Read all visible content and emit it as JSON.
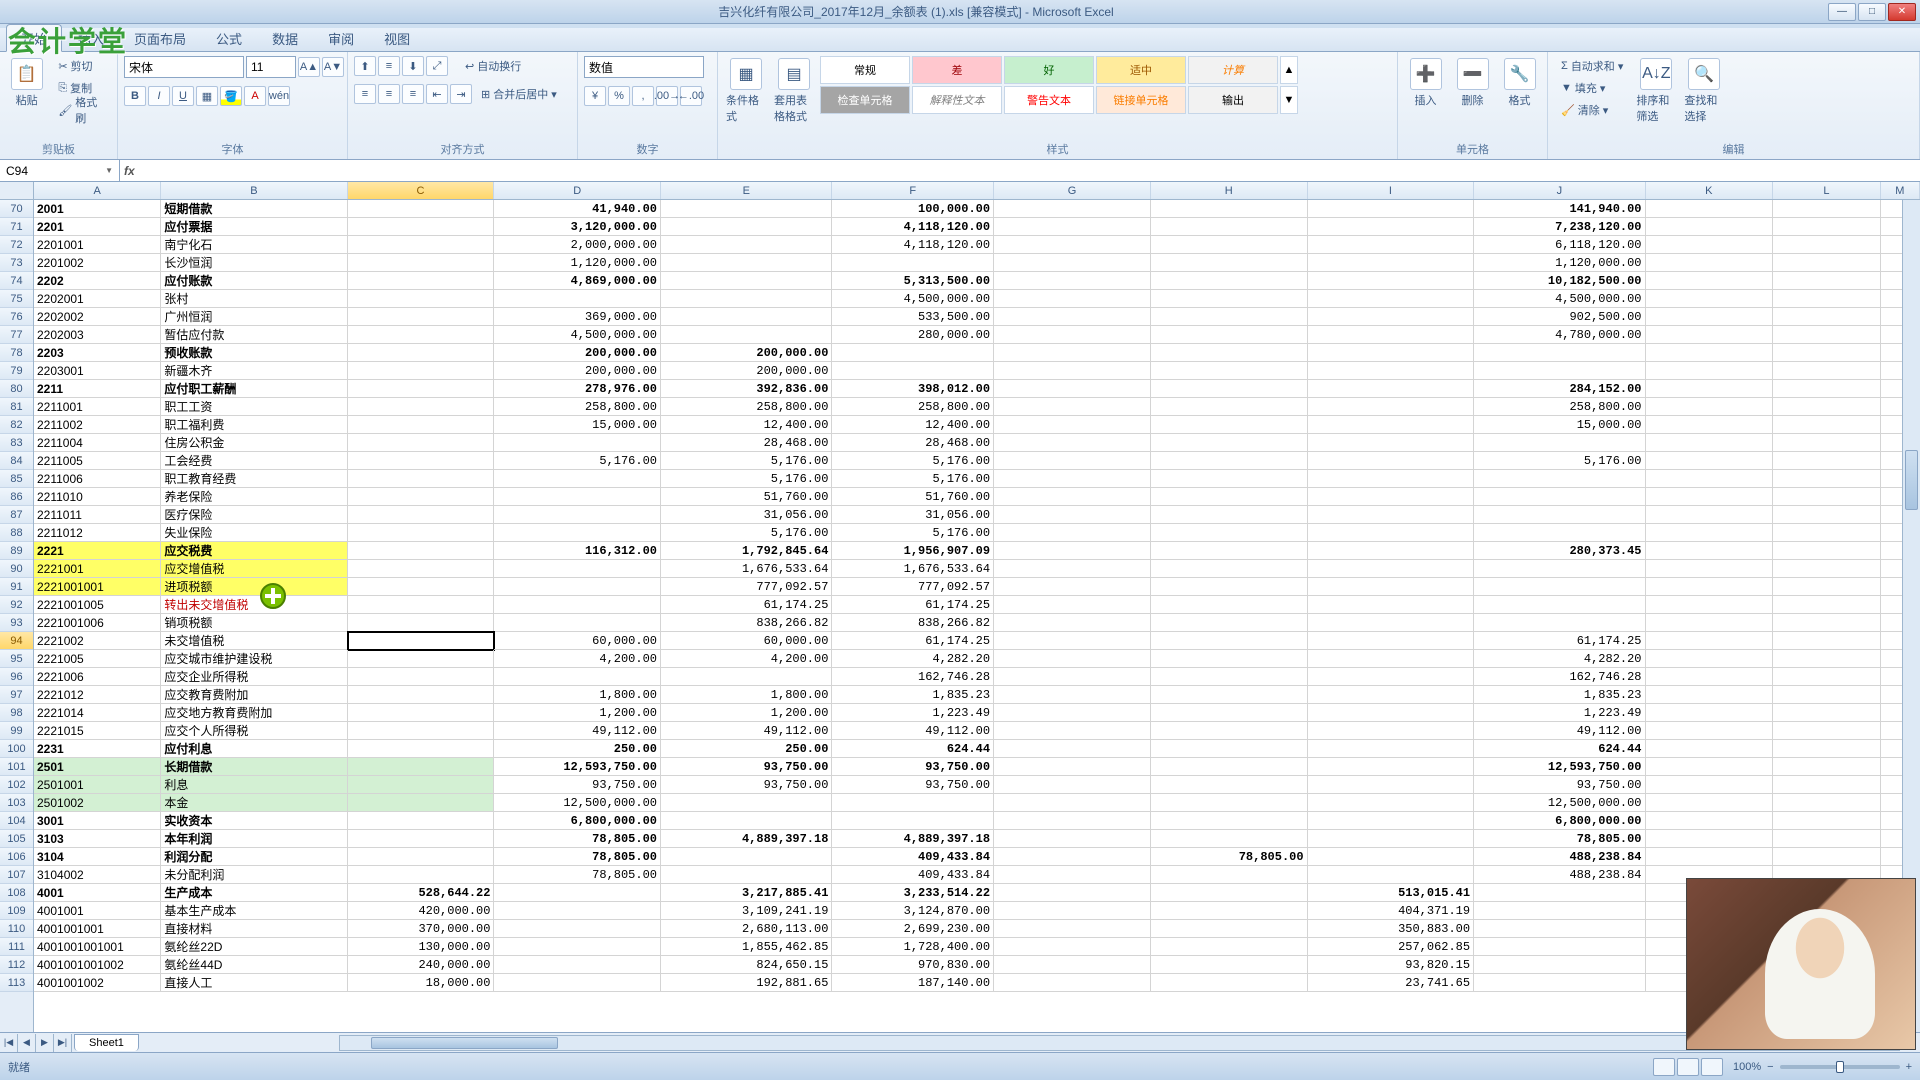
{
  "window": {
    "title": "吉兴化纤有限公司_2017年12月_余额表 (1).xls [兼容模式] - Microsoft Excel"
  },
  "logo": "会计学堂",
  "menu": {
    "tabs": [
      "开始",
      "插入",
      "页面布局",
      "公式",
      "数据",
      "审阅",
      "视图"
    ],
    "activeIndex": 0
  },
  "ribbon": {
    "clipboard": {
      "paste": "粘贴",
      "cut": "剪切",
      "copy": "复制",
      "formatPainter": "格式刷",
      "label": "剪贴板"
    },
    "font": {
      "name": "宋体",
      "size": "11",
      "bold": "B",
      "italic": "I",
      "underline": "U",
      "label": "字体"
    },
    "align": {
      "wrap": "自动换行",
      "merge": "合并后居中",
      "label": "对齐方式"
    },
    "number": {
      "format": "数值",
      "pct": "%",
      "comma": ",",
      "label": "数字"
    },
    "styles": {
      "condfmt": "条件格式",
      "tablefmt": "套用表格格式",
      "cellstyle": "单元格样式",
      "gallery": [
        {
          "k": "normal",
          "t": "常规"
        },
        {
          "k": "bad",
          "t": "差"
        },
        {
          "k": "good",
          "t": "好"
        },
        {
          "k": "neutral",
          "t": "适中"
        },
        {
          "k": "calc",
          "t": "计算"
        },
        {
          "k": "check",
          "t": "检查单元格"
        },
        {
          "k": "explain",
          "t": "解释性文本"
        },
        {
          "k": "warn",
          "t": "警告文本"
        },
        {
          "k": "linked",
          "t": "链接单元格"
        },
        {
          "k": "output",
          "t": "输出"
        }
      ],
      "label": "样式"
    },
    "cells": {
      "insert": "插入",
      "delete": "删除",
      "format": "格式",
      "label": "单元格"
    },
    "editing": {
      "autosum": "自动求和",
      "fill": "填充",
      "clear": "清除",
      "sortfilter": "排序和筛选",
      "findselect": "查找和选择",
      "label": "编辑"
    }
  },
  "fbar": {
    "name": "C94",
    "fx": "fx",
    "value": ""
  },
  "cols": [
    "A",
    "B",
    "C",
    "D",
    "E",
    "F",
    "G",
    "H",
    "I",
    "J",
    "K",
    "L",
    "M"
  ],
  "colClasses": [
    "cA",
    "cB",
    "cC",
    "cD",
    "cE",
    "cF",
    "cG",
    "cH",
    "cI",
    "cJ",
    "cK",
    "cL",
    "cM"
  ],
  "firstRow": 70,
  "activeRow": 94,
  "activeCol": 2,
  "hlRows": [
    101,
    102,
    103
  ],
  "hlRange": {
    "rowStart": 89,
    "rowEnd": 91,
    "colStart": 0,
    "colEnd": 1
  },
  "cursor": {
    "row": 91,
    "col": 1
  },
  "rows": [
    {
      "n": 70,
      "b": 1,
      "A": "2001",
      "B": "短期借款",
      "D": "41,940.00",
      "F": "100,000.00",
      "J": "141,940.00"
    },
    {
      "n": 71,
      "b": 1,
      "A": "2201",
      "B": "应付票据",
      "D": "3,120,000.00",
      "F": "4,118,120.00",
      "J": "7,238,120.00"
    },
    {
      "n": 72,
      "A": "2201001",
      "B": "南宁化石",
      "D": "2,000,000.00",
      "F": "4,118,120.00",
      "J": "6,118,120.00"
    },
    {
      "n": 73,
      "A": "2201002",
      "B": "长沙恒润",
      "D": "1,120,000.00",
      "J": "1,120,000.00"
    },
    {
      "n": 74,
      "b": 1,
      "A": "2202",
      "B": "应付账款",
      "D": "4,869,000.00",
      "F": "5,313,500.00",
      "J": "10,182,500.00"
    },
    {
      "n": 75,
      "A": "2202001",
      "B": "张村",
      "F": "4,500,000.00",
      "J": "4,500,000.00"
    },
    {
      "n": 76,
      "A": "2202002",
      "B": "广州恒润",
      "D": "369,000.00",
      "F": "533,500.00",
      "J": "902,500.00"
    },
    {
      "n": 77,
      "A": "2202003",
      "B": "暂估应付款",
      "D": "4,500,000.00",
      "F": "280,000.00",
      "J": "4,780,000.00"
    },
    {
      "n": 78,
      "b": 1,
      "A": "2203",
      "B": "预收账款",
      "D": "200,000.00",
      "E": "200,000.00"
    },
    {
      "n": 79,
      "A": "2203001",
      "B": "新疆木齐",
      "D": "200,000.00",
      "E": "200,000.00"
    },
    {
      "n": 80,
      "b": 1,
      "A": "2211",
      "B": "应付职工薪酬",
      "D": "278,976.00",
      "E": "392,836.00",
      "F": "398,012.00",
      "J": "284,152.00"
    },
    {
      "n": 81,
      "A": "2211001",
      "B": "职工工资",
      "D": "258,800.00",
      "E": "258,800.00",
      "F": "258,800.00",
      "J": "258,800.00"
    },
    {
      "n": 82,
      "A": "2211002",
      "B": "职工福利费",
      "D": "15,000.00",
      "E": "12,400.00",
      "F": "12,400.00",
      "J": "15,000.00"
    },
    {
      "n": 83,
      "A": "2211004",
      "B": "住房公积金",
      "E": "28,468.00",
      "F": "28,468.00"
    },
    {
      "n": 84,
      "A": "2211005",
      "B": "工会经费",
      "D": "5,176.00",
      "E": "5,176.00",
      "F": "5,176.00",
      "J": "5,176.00"
    },
    {
      "n": 85,
      "A": "2211006",
      "B": "职工教育经费",
      "E": "5,176.00",
      "F": "5,176.00"
    },
    {
      "n": 86,
      "A": "2211010",
      "B": "养老保险",
      "E": "51,760.00",
      "F": "51,760.00"
    },
    {
      "n": 87,
      "A": "2211011",
      "B": "医疗保险",
      "E": "31,056.00",
      "F": "31,056.00"
    },
    {
      "n": 88,
      "A": "2211012",
      "B": "失业保险",
      "E": "5,176.00",
      "F": "5,176.00"
    },
    {
      "n": 89,
      "b": 1,
      "A": "2221",
      "B": "应交税费",
      "D": "116,312.00",
      "E": "1,792,845.64",
      "F": "1,956,907.09",
      "J": "280,373.45"
    },
    {
      "n": 90,
      "A": "2221001",
      "B": "应交增值税",
      "E": "1,676,533.64",
      "F": "1,676,533.64"
    },
    {
      "n": 91,
      "A": "2221001001",
      "B": "进项税额",
      "E": "777,092.57",
      "F": "777,092.57"
    },
    {
      "n": 92,
      "A": "2221001005",
      "B": "转出未交增值税",
      "red": 1,
      "E": "61,174.25",
      "F": "61,174.25"
    },
    {
      "n": 93,
      "A": "2221001006",
      "B": "销项税额",
      "E": "838,266.82",
      "F": "838,266.82"
    },
    {
      "n": 94,
      "A": "2221002",
      "B": "未交增值税",
      "D": "60,000.00",
      "E": "60,000.00",
      "F": "61,174.25",
      "J": "61,174.25"
    },
    {
      "n": 95,
      "A": "2221005",
      "B": "应交城市维护建设税",
      "D": "4,200.00",
      "E": "4,200.00",
      "F": "4,282.20",
      "J": "4,282.20"
    },
    {
      "n": 96,
      "A": "2221006",
      "B": "应交企业所得税",
      "F": "162,746.28",
      "J": "162,746.28"
    },
    {
      "n": 97,
      "A": "2221012",
      "B": "应交教育费附加",
      "D": "1,800.00",
      "E": "1,800.00",
      "F": "1,835.23",
      "J": "1,835.23"
    },
    {
      "n": 98,
      "A": "2221014",
      "B": "应交地方教育费附加",
      "D": "1,200.00",
      "E": "1,200.00",
      "F": "1,223.49",
      "J": "1,223.49"
    },
    {
      "n": 99,
      "A": "2221015",
      "B": "应交个人所得税",
      "D": "49,112.00",
      "E": "49,112.00",
      "F": "49,112.00",
      "J": "49,112.00"
    },
    {
      "n": 100,
      "b": 1,
      "A": "2231",
      "B": "应付利息",
      "D": "250.00",
      "E": "250.00",
      "F": "624.44",
      "J": "624.44"
    },
    {
      "n": 101,
      "b": 1,
      "A": "2501",
      "B": "长期借款",
      "D": "12,593,750.00",
      "E": "93,750.00",
      "F": "93,750.00",
      "J": "12,593,750.00"
    },
    {
      "n": 102,
      "A": "2501001",
      "B": "利息",
      "D": "93,750.00",
      "E": "93,750.00",
      "F": "93,750.00",
      "J": "93,750.00"
    },
    {
      "n": 103,
      "A": "2501002",
      "B": "本金",
      "D": "12,500,000.00",
      "J": "12,500,000.00"
    },
    {
      "n": 104,
      "b": 1,
      "A": "3001",
      "B": "实收资本",
      "D": "6,800,000.00",
      "J": "6,800,000.00"
    },
    {
      "n": 105,
      "b": 1,
      "A": "3103",
      "B": "本年利润",
      "D": "78,805.00",
      "E": "4,889,397.18",
      "F": "4,889,397.18",
      "J": "78,805.00"
    },
    {
      "n": 106,
      "b": 1,
      "A": "3104",
      "B": "利润分配",
      "D": "78,805.00",
      "F": "409,433.84",
      "H": "78,805.00",
      "J": "488,238.84"
    },
    {
      "n": 107,
      "A": "3104002",
      "B": "未分配利润",
      "D": "78,805.00",
      "F": "409,433.84",
      "J": "488,238.84"
    },
    {
      "n": 108,
      "b": 1,
      "A": "4001",
      "B": "生产成本",
      "C": "528,644.22",
      "E": "3,217,885.41",
      "F": "3,233,514.22",
      "I": "513,015.41"
    },
    {
      "n": 109,
      "A": "4001001",
      "B": "基本生产成本",
      "C": "420,000.00",
      "E": "3,109,241.19",
      "F": "3,124,870.00",
      "I": "404,371.19"
    },
    {
      "n": 110,
      "A": "4001001001",
      "B": "直接材料",
      "C": "370,000.00",
      "E": "2,680,113.00",
      "F": "2,699,230.00",
      "I": "350,883.00"
    },
    {
      "n": 111,
      "A": "40010010010­01",
      "B": "氨纶丝22D",
      "C": "130,000.00",
      "E": "1,855,462.85",
      "F": "1,728,400.00",
      "I": "257,062.85"
    },
    {
      "n": 112,
      "A": "4001001001002",
      "B": "氨纶丝44D",
      "C": "240,000.00",
      "E": "824,650.15",
      "F": "970,830.00",
      "I": "93,820.15"
    },
    {
      "n": 113,
      "A": "4001001002",
      "B": "直接人工",
      "C": "18,000.00",
      "E": "192,881.65",
      "F": "187,140.00",
      "I": "23,741.65"
    }
  ],
  "sheetTab": "Sheet1",
  "status": {
    "ready": "就绪",
    "zoom": "100%"
  }
}
